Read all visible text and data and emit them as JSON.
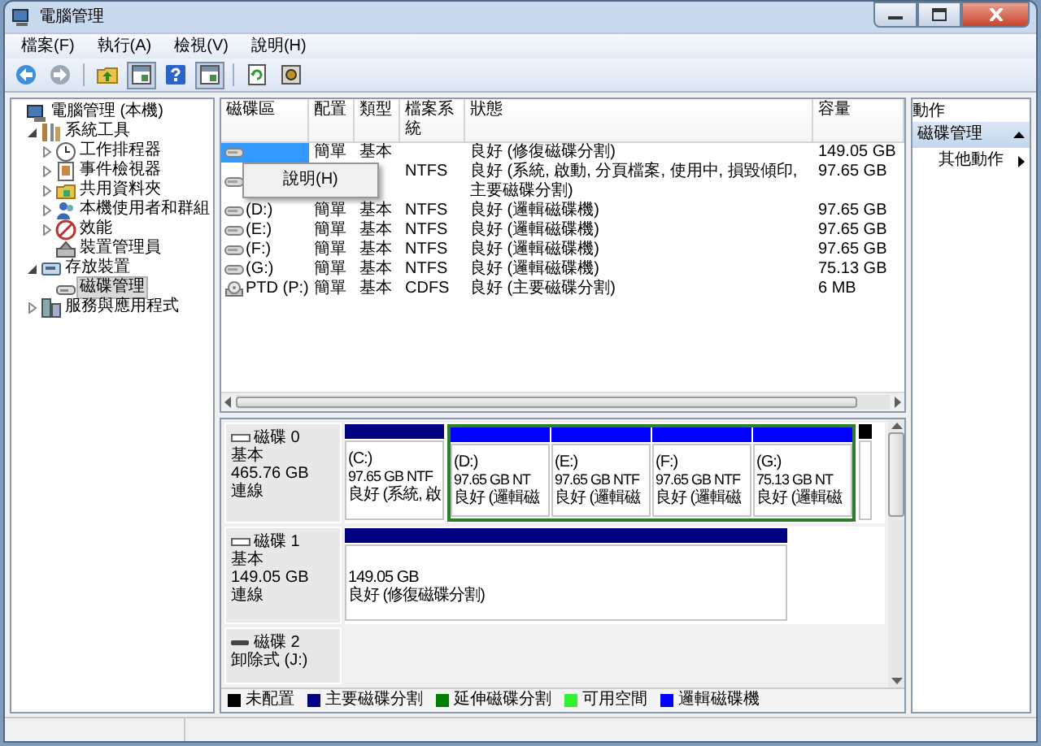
{
  "window": {
    "title": "電腦管理"
  },
  "menu": [
    {
      "label": "檔案(F)"
    },
    {
      "label": "執行(A)"
    },
    {
      "label": "檢視(V)"
    },
    {
      "label": "說明(H)"
    }
  ],
  "toolbar": [
    {
      "kind": "back",
      "pressed": false
    },
    {
      "kind": "forward",
      "pressed": false
    },
    {
      "kind": "up",
      "pressed": false
    },
    {
      "kind": "panel",
      "pressed": true
    },
    {
      "kind": "help",
      "pressed": false
    },
    {
      "kind": "panel",
      "pressed": true
    },
    {
      "kind": "refresh",
      "pressed": false
    },
    {
      "kind": "properties",
      "pressed": false
    }
  ],
  "tree": [
    {
      "label": "電腦管理 (本機)",
      "selected": false,
      "children": [
        {
          "label": "系統工具",
          "expanded": true,
          "selected": false,
          "children": [
            {
              "label": "工作排程器",
              "expanded": false,
              "selected": false
            },
            {
              "label": "事件檢視器",
              "expanded": false,
              "selected": false
            },
            {
              "label": "共用資料夾",
              "expanded": false,
              "selected": false
            },
            {
              "label": "本機使用者和群組",
              "expanded": false,
              "selected": false
            },
            {
              "label": "效能",
              "expanded": false,
              "selected": false
            },
            {
              "label": "裝置管理員",
              "selected": false
            }
          ]
        },
        {
          "label": "存放裝置",
          "expanded": true,
          "selected": false,
          "children": [
            {
              "label": "磁碟管理",
              "selected": true
            }
          ]
        },
        {
          "label": "服務與應用程式",
          "expanded": false,
          "selected": false
        }
      ]
    }
  ],
  "volumes": {
    "columns": [
      {
        "label": "磁碟區"
      },
      {
        "label": "配置"
      },
      {
        "label": "類型"
      },
      {
        "label": "檔案系統"
      },
      {
        "label": "狀態"
      },
      {
        "label": "容量"
      }
    ],
    "rows": [
      {
        "kind": "disk",
        "selected": true,
        "cells": [
          null,
          "簡單",
          "基本",
          null,
          "良好 (修復磁碟分割)",
          "149.05 GB"
        ]
      },
      {
        "kind": "disk",
        "selected": false,
        "cells": [
          null,
          null,
          null,
          "NTFS",
          "良好 (系統, 啟動, 分頁檔案, 使用中, 損毀傾印, 主要磁碟分割)",
          "97.65 GB"
        ]
      },
      {
        "kind": "disk",
        "selected": false,
        "cells": [
          "(D:)",
          "簡單",
          "基本",
          "NTFS",
          "良好 (邏輯磁碟機)",
          "97.65 GB"
        ]
      },
      {
        "kind": "disk",
        "selected": false,
        "cells": [
          "(E:)",
          "簡單",
          "基本",
          "NTFS",
          "良好 (邏輯磁碟機)",
          "97.65 GB"
        ]
      },
      {
        "kind": "disk",
        "selected": false,
        "cells": [
          "(F:)",
          "簡單",
          "基本",
          "NTFS",
          "良好 (邏輯磁碟機)",
          "97.65 GB"
        ]
      },
      {
        "kind": "disk",
        "selected": false,
        "cells": [
          "(G:)",
          "簡單",
          "基本",
          "NTFS",
          "良好 (邏輯磁碟機)",
          "75.13 GB"
        ]
      },
      {
        "kind": "cdrom",
        "selected": false,
        "cells": [
          "PTD (P:)",
          "簡單",
          "基本",
          "CDFS",
          "良好 (主要磁碟分割)",
          "6 MB"
        ]
      }
    ],
    "context_menu": {
      "items": [
        {
          "label": "說明(H)"
        }
      ]
    }
  },
  "disks": [
    {
      "kind": "fixed",
      "name": "磁碟 0",
      "type": "基本",
      "size": "465.76 GB",
      "status": "連線",
      "partitions": [
        {
          "kind": "primary",
          "letter": "(C:)",
          "size": "97.65 GB NTF",
          "status": "良好 (系統, 啟"
        },
        {
          "kind": "extended",
          "children": [
            {
              "kind": "logical",
              "letter": "(D:)",
              "size": "97.65 GB NT",
              "status": "良好 (邏輯磁"
            },
            {
              "kind": "logical",
              "letter": "(E:)",
              "size": "97.65 GB NTF",
              "status": "良好 (邏輯磁"
            },
            {
              "kind": "logical",
              "letter": "(F:)",
              "size": "97.65 GB NTF",
              "status": "良好 (邏輯磁"
            },
            {
              "kind": "logical",
              "letter": "(G:)",
              "size": "75.13 GB NT",
              "status": "良好 (邏輯磁"
            }
          ]
        },
        {
          "kind": "unallocated"
        }
      ]
    },
    {
      "kind": "fixed",
      "name": "磁碟 1",
      "type": "基本",
      "size": "149.05 GB",
      "status": "連線",
      "partitions": [
        {
          "kind": "primary",
          "size": "149.05 GB",
          "status": "良好 (修復磁碟分割)"
        }
      ]
    },
    {
      "kind": "removable",
      "name": "磁碟 2",
      "type": "卸除式 (J:)"
    }
  ],
  "legend": [
    {
      "kind": "unallocated",
      "label": "未配置",
      "color": "#000000"
    },
    {
      "kind": "primary",
      "label": "主要磁碟分割",
      "color": "#000080"
    },
    {
      "kind": "extended",
      "label": "延伸磁碟分割",
      "color": "#008000"
    },
    {
      "kind": "free",
      "label": "可用空間",
      "color": "#33ee33"
    },
    {
      "kind": "logical",
      "label": "邏輯磁碟機",
      "color": "#0000ff"
    }
  ],
  "actions": {
    "title": "動作",
    "sections": [
      {
        "title": "磁碟管理",
        "expanded": true,
        "items": [
          {
            "label": "其他動作"
          }
        ]
      }
    ]
  }
}
